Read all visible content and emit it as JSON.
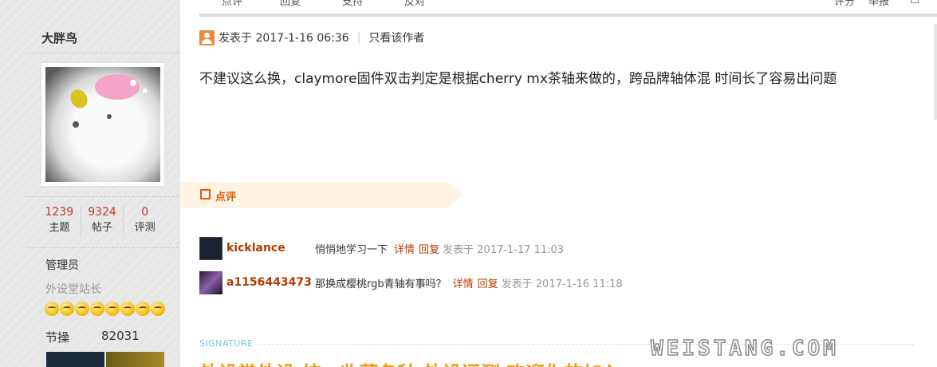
{
  "author": {
    "name": "大胖鸟",
    "stats": [
      {
        "value": "1239",
        "label": "主题"
      },
      {
        "value": "9324",
        "label": "帖子"
      },
      {
        "value": "0",
        "label": "评测"
      }
    ],
    "role": "管理员",
    "subrole": "外设堂站长",
    "rank_face_count": 8,
    "credit_label": "节操",
    "credit_value": "82031"
  },
  "top_actions": {
    "dianzan": "点评",
    "huifu": "回复",
    "zhichi": "支持",
    "fandui": "反对",
    "pingfen": "评分",
    "jubao": "举报",
    "top": "□"
  },
  "post": {
    "meta_prefix": "发表于 2017-1-16 06:36",
    "only_author": "只看该作者",
    "body": "不建议这么换，claymore固件双击判定是根据cherry mx茶轴来做的，跨品牌轴体混 时间长了容易出问题"
  },
  "dianping": {
    "label": "点评",
    "comments": [
      {
        "user": "kicklance",
        "text": "悄悄地学习一下",
        "detail": "详情",
        "reply": "回复",
        "time": "发表于 2017-1-17 11:03"
      },
      {
        "user": "a1156443473",
        "text": "那换成樱桃rgb青轴有事吗？",
        "detail": "详情",
        "reply": "回复",
        "time": "发表于 2017-1-16 11:18"
      }
    ]
  },
  "signature": {
    "label": "SIGNATURE",
    "text": "外设堂外设 统一收藏各种 外设评测 欢迎你的加入"
  },
  "watermark": "WEISTANG.COM",
  "colors": {
    "accent": "#b03a00",
    "orange": "#e05a0a",
    "sig_orange": "#f39c12"
  }
}
